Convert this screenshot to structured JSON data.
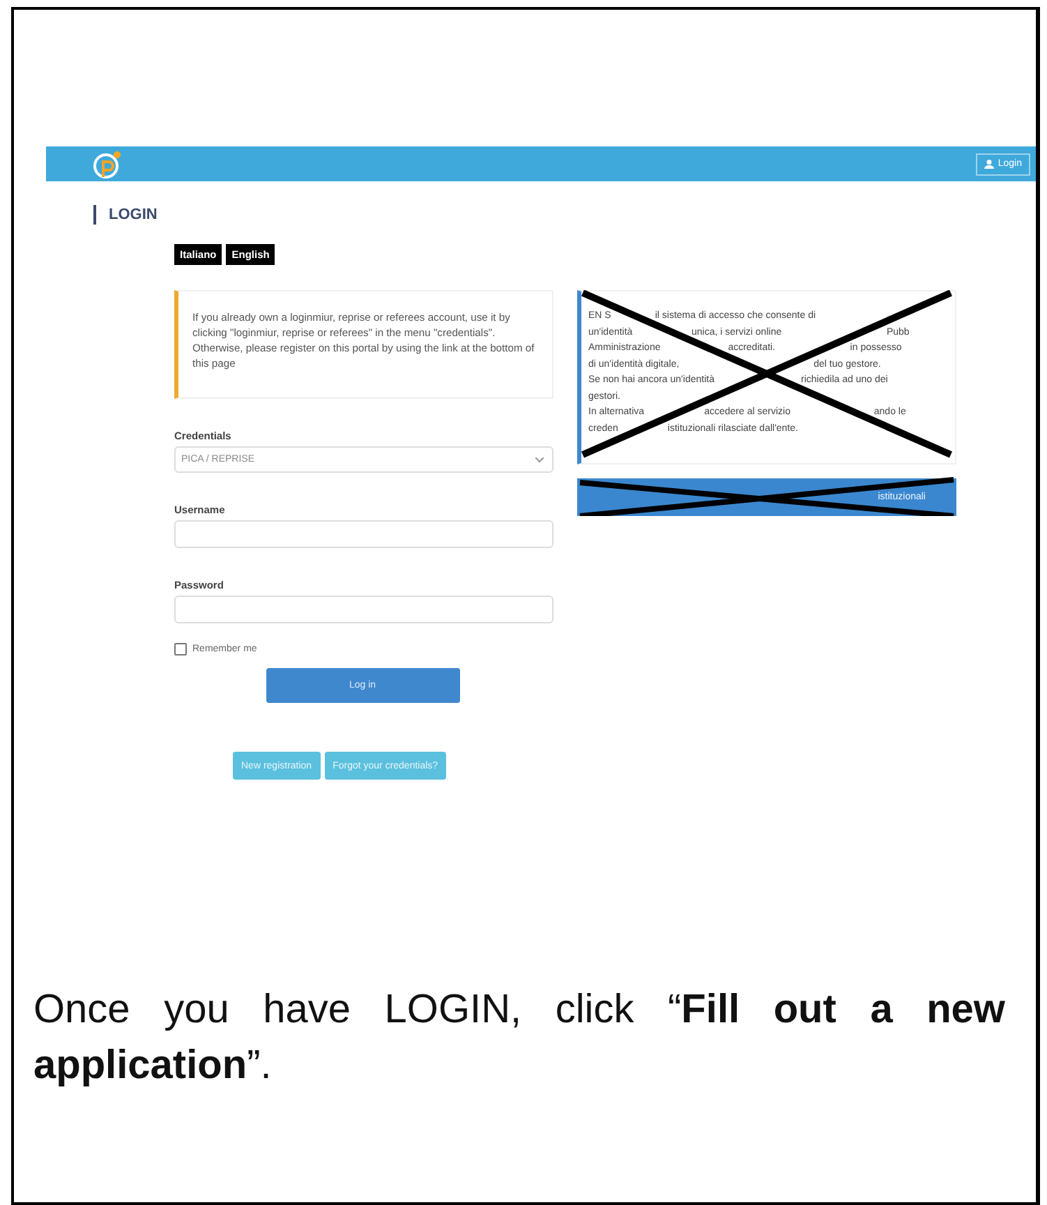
{
  "header": {
    "login_button": "Login"
  },
  "page_title": "LOGIN",
  "languages": [
    {
      "label": "Italiano"
    },
    {
      "label": "English"
    }
  ],
  "info_text": "If you already own a loginmiur, reprise or referees account, use it by clicking \"loginmiur, reprise or referees\" in the menu \"credentials\". Otherwise, please register on this portal by using the link at the bottom of this page",
  "form": {
    "credentials_label": "Credentials",
    "credentials_value": "PICA / REPRISE",
    "username_label": "Username",
    "password_label": "Password",
    "remember_label": "Remember me",
    "remember_checked": false,
    "login_button": "Log in"
  },
  "bottom_buttons": [
    "New registration",
    "Forgot your credentials?"
  ],
  "crossed_lines": [
    {
      "left": "EN S",
      "middle": "il sistema di accesso che consente di"
    },
    {
      "left": "un'identità",
      "middle": "unica, i servizi online",
      "right": "Pubb"
    },
    {
      "left": "Amministrazione",
      "middle": "accreditati.",
      "right": "in possesso"
    },
    {
      "left": "di un'identità digitale,",
      "right": "del tuo gestore."
    },
    {
      "left": "Se non hai ancora un'identità",
      "right": "richiedila ad uno dei"
    },
    {
      "left": "gestori."
    },
    {
      "left": "In alternativa",
      "middle": "accedere al servizio",
      "right": "ando le"
    },
    {
      "left": "creden",
      "middle": "istituzionali rilasciate dall'ente."
    }
  ],
  "crossed_button": "istituzionali",
  "caption": "Once you have LOGIN, click “**Fill out a new application**”."
}
